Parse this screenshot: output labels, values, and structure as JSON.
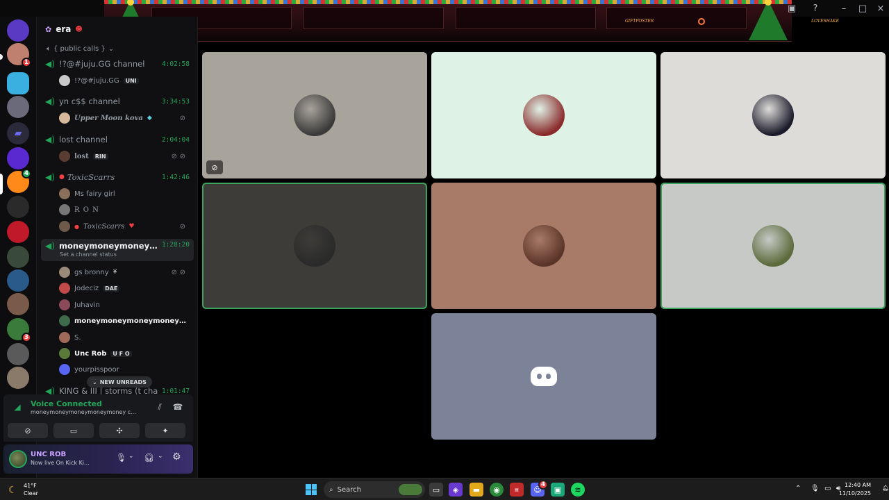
{
  "window": {
    "banner_left": "GIFTPOSTER",
    "banner_right": "LOVESHAKE"
  },
  "server": {
    "name": "era"
  },
  "category": {
    "label": "{ public calls }"
  },
  "voice_channels": [
    {
      "name": "!?@#juju.GG channel",
      "timer": "4:02:58",
      "members": [
        {
          "name": "!?@#juju.GG",
          "tag": "UNI",
          "color": "#c9c9c9"
        }
      ]
    },
    {
      "name": "yn c$$ channel",
      "timer": "3:34:53",
      "members": [
        {
          "name": "Upper Moon kova",
          "tag": "",
          "color": "#d8b89a"
        }
      ]
    },
    {
      "name": "lost channel",
      "timer": "2:04:04",
      "members": [
        {
          "name": "lost",
          "tag": "RIN",
          "color": "#5a3d32"
        }
      ]
    },
    {
      "name": "ToxicScarrs",
      "timer": "1:42:46",
      "members": [
        {
          "name": "Ms fairy girl",
          "tag": "",
          "color": "#8a6f5a"
        },
        {
          "name": "R O N",
          "tag": "",
          "color": "#777777"
        },
        {
          "name": "ToxicScarrs",
          "tag": "",
          "color": "#6e5a4a"
        }
      ]
    },
    {
      "name": "moneymoneymoneymon...",
      "timer": "1:28:20",
      "status": "Set a channel status",
      "members": [
        {
          "name": "gs bronny",
          "tag": "",
          "color": "#9a8a7a"
        },
        {
          "name": "Jodeciz",
          "tag": "DAE",
          "color": "#c24a4a"
        },
        {
          "name": "Juhavin",
          "tag": "",
          "color": "#8a4a5a"
        },
        {
          "name": "moneymoneymoneymoneymoney...",
          "tag": "",
          "color": "#3f6b4a"
        },
        {
          "name": "S.",
          "tag": "",
          "color": "#a06a5a"
        },
        {
          "name": "Unc Rob",
          "tag": "U F O",
          "color": "#5a7a3a"
        },
        {
          "name": "yourpisspoor",
          "tag": "",
          "color": "#5865f2"
        }
      ]
    },
    {
      "name": "KING & III | storms (t cha",
      "timer": "1:01:47",
      "members": []
    }
  ],
  "new_unreads_label": "NEW UNREADS",
  "voice_panel": {
    "status": "Voice Connected",
    "channel": "moneymoneymoneymoneymoney c..."
  },
  "user_panel": {
    "name": "UNC ROB",
    "status": "Now live On Kick Ki..."
  },
  "tiles": [
    {
      "bg": "#a8a39b",
      "avatar": "#3a3a3a",
      "speaking": false,
      "video_off": true
    },
    {
      "bg": "#dff2e6",
      "avatar": "#8a2a2a",
      "speaking": false,
      "video_off": false
    },
    {
      "bg": "#dedcd9",
      "avatar": "#1a1a2a",
      "speaking": false,
      "video_off": false
    },
    {
      "bg": "#3d3c39",
      "avatar": "#2a2a2a",
      "speaking": true,
      "video_off": false
    },
    {
      "bg": "#a87b68",
      "avatar": "#5a3428",
      "speaking": false,
      "video_off": false
    },
    {
      "bg": "#c7c9c6",
      "avatar": "#5a6a3a",
      "speaking": true,
      "video_off": false
    },
    {
      "bg": "#7c8297",
      "avatar": "discord-default",
      "speaking": false,
      "video_off": false
    }
  ],
  "taskbar": {
    "weather_temp": "41°F",
    "weather_desc": "Clear",
    "search_placeholder": "Search",
    "time": "12:40 AM",
    "date": "11/10/2025"
  },
  "badges": {
    "server_2": "1",
    "server_8": "4",
    "server_16": "3",
    "discord_taskbar": "4"
  },
  "colors": {
    "accent_green": "#23a55a",
    "blurple": "#5865f2",
    "danger": "#f23f43"
  }
}
